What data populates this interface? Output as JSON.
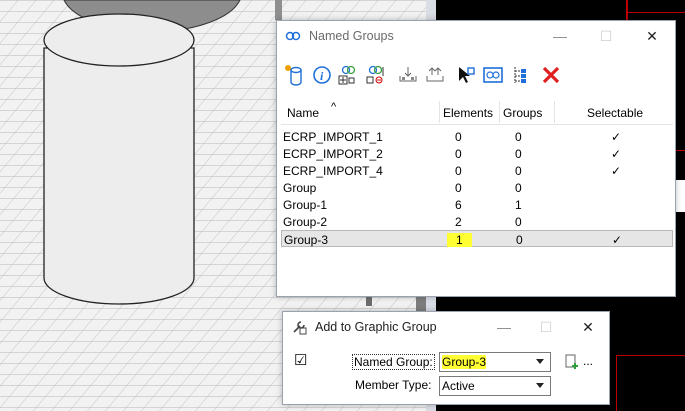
{
  "named_groups": {
    "title": "Named Groups",
    "window_controls": {
      "minimize": "—",
      "maximize": "☐",
      "close": "✕"
    },
    "toolbar_icons": [
      "add-group-icon",
      "info-icon",
      "add-members-icon",
      "remove-members-icon",
      "select-members-icon",
      "deselect-members-icon",
      "pick-group-icon",
      "display-icon",
      "hierarchy-icon",
      "delete-icon"
    ],
    "columns": {
      "name": "Name",
      "sort": "^",
      "elements": "Elements",
      "groups": "Groups",
      "selectable": "Selectable"
    },
    "rows": [
      {
        "name": "ECRP_IMPORT_1",
        "elements": "0",
        "groups": "0",
        "selectable": "✓"
      },
      {
        "name": "ECRP_IMPORT_2",
        "elements": "0",
        "groups": "0",
        "selectable": "✓"
      },
      {
        "name": "ECRP_IMPORT_4",
        "elements": "0",
        "groups": "0",
        "selectable": "✓"
      },
      {
        "name": "Group",
        "elements": "0",
        "groups": "0",
        "selectable": ""
      },
      {
        "name": "Group-1",
        "elements": "6",
        "groups": "1",
        "selectable": ""
      },
      {
        "name": "Group-2",
        "elements": "2",
        "groups": "0",
        "selectable": ""
      },
      {
        "name": "Group-3",
        "elements": "1",
        "groups": "0",
        "selectable": "✓"
      }
    ]
  },
  "add_to_group": {
    "title": "Add to Graphic Group",
    "window_controls": {
      "minimize": "—",
      "maximize": "☐",
      "close": "✕"
    },
    "checkbox": "☑",
    "named_group_label": "Named Group:",
    "named_group_value": "Group-3",
    "member_type_label": "Member Type:",
    "member_type_value": "Active",
    "more": "..."
  },
  "colors": {
    "highlight": "#ffff33",
    "accent": "#1e6fd9"
  }
}
